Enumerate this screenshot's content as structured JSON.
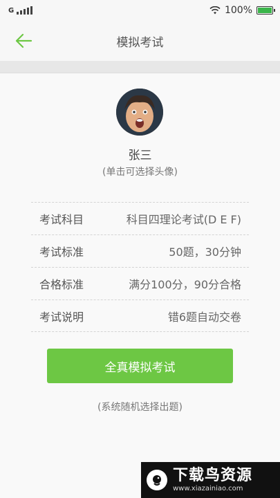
{
  "status_bar": {
    "carrier": "G",
    "battery_text": "100%",
    "battery_level": 1.0,
    "battery_color": "#3ab54a"
  },
  "nav": {
    "title": "模拟考试",
    "back_icon": "back-arrow-icon",
    "accent": "#6dc744"
  },
  "profile": {
    "name": "张三",
    "hint": "(单击可选择头像)"
  },
  "exam_info": [
    {
      "label": "考试科目",
      "value": "科目四理论考试(D E F)"
    },
    {
      "label": "考试标准",
      "value": "50题，30分钟"
    },
    {
      "label": "合格标准",
      "value": "满分100分，90分合格"
    },
    {
      "label": "考试说明",
      "value": "错6题自动交卷"
    }
  ],
  "start_button": {
    "label": "全真模拟考试",
    "color": "#6dc744"
  },
  "random_note": "(系统随机选择出题)",
  "watermark": {
    "main": "下载鸟资源",
    "url": "www.xiazainiao.com"
  }
}
